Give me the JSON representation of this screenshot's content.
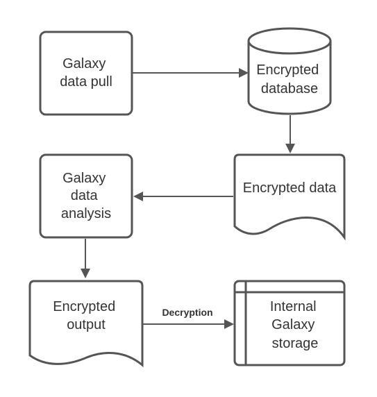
{
  "colors": {
    "stroke": "#555555",
    "fill": "#ffffff",
    "text": "#333333"
  },
  "nodes": {
    "galaxy_data_pull": {
      "shape": "rounded-rectangle",
      "lines": [
        "Galaxy",
        "data pull"
      ]
    },
    "encrypted_database": {
      "shape": "cylinder",
      "lines": [
        "Encrypted",
        "database"
      ]
    },
    "encrypted_data": {
      "shape": "document",
      "lines": [
        "Encrypted data"
      ]
    },
    "galaxy_data_analysis": {
      "shape": "rounded-rectangle",
      "lines": [
        "Galaxy",
        "data",
        "analysis"
      ]
    },
    "encrypted_output": {
      "shape": "document",
      "lines": [
        "Encrypted",
        "output"
      ]
    },
    "internal_galaxy_storage": {
      "shape": "internal-storage",
      "lines": [
        "Internal",
        "Galaxy",
        "storage"
      ]
    }
  },
  "edges": [
    {
      "from": "galaxy_data_pull",
      "to": "encrypted_database",
      "label": ""
    },
    {
      "from": "encrypted_database",
      "to": "encrypted_data",
      "label": ""
    },
    {
      "from": "encrypted_data",
      "to": "galaxy_data_analysis",
      "label": ""
    },
    {
      "from": "galaxy_data_analysis",
      "to": "encrypted_output",
      "label": ""
    },
    {
      "from": "encrypted_output",
      "to": "internal_galaxy_storage",
      "label": "Decryption"
    }
  ]
}
